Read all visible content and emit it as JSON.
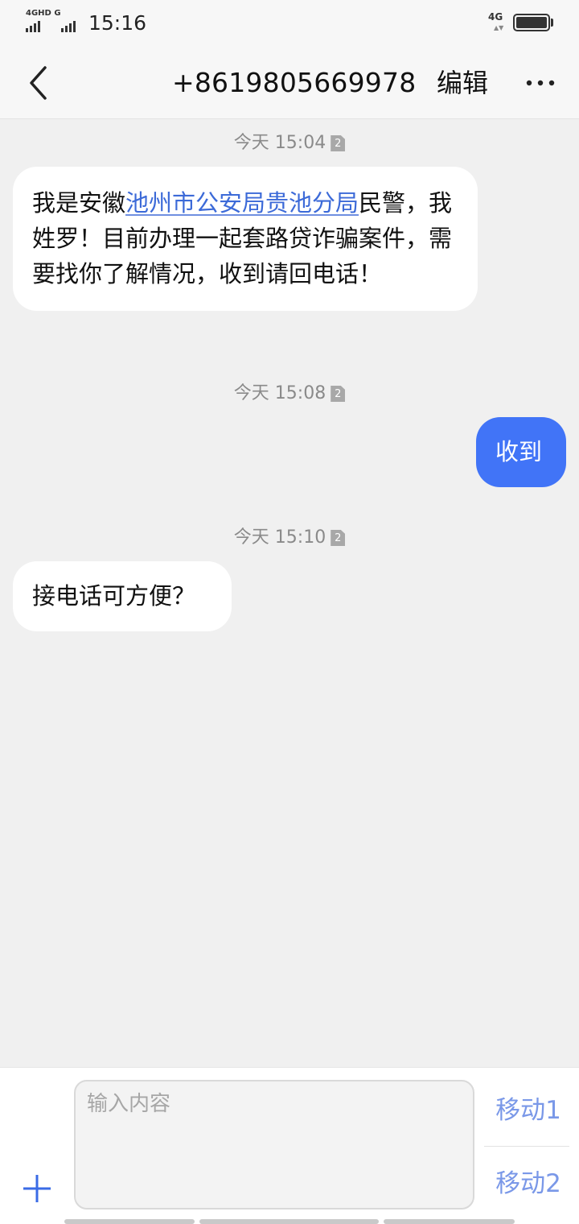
{
  "status_bar": {
    "sim1_label": "4GHD G",
    "time": "15:16",
    "network": "4G",
    "network_arrows": "▲▼"
  },
  "header": {
    "title": "+8619805669978",
    "edit_label": "编辑"
  },
  "messages": [
    {
      "timestamp": "今天 15:04",
      "sim": "2",
      "direction": "incoming",
      "text_before": "我是安徽",
      "link": "池州市公安局贵池分局",
      "text_after": "民警，我姓罗！目前办理一起套路贷诈骗案件，需要找你了解情况，收到请回电话！"
    },
    {
      "timestamp": "今天 15:08",
      "sim": "2",
      "direction": "outgoing",
      "text": "收到"
    },
    {
      "timestamp": "今天 15:10",
      "sim": "2",
      "direction": "incoming",
      "text": "接电话可方便？"
    }
  ],
  "composer": {
    "placeholder": "输入内容",
    "send_sim1_label": "移动1",
    "send_sim2_label": "移动2"
  },
  "colors": {
    "background": "#f0f0f0",
    "outgoing_bubble": "#4174f7",
    "incoming_bubble": "#ffffff",
    "link": "#3c6ad8",
    "send_label": "#7a98e8"
  }
}
